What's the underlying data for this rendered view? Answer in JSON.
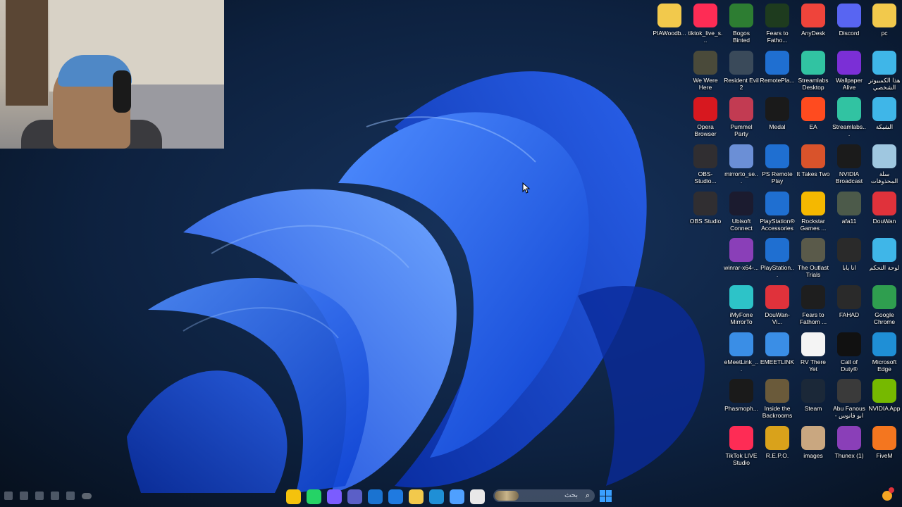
{
  "desktop": {
    "icons": [
      {
        "label": "PIAWoodb...",
        "col": 0,
        "row": 0,
        "icon": "folder-icon",
        "color": "#f2c94c"
      },
      {
        "label": "tiktok_live_s...",
        "col": 1,
        "row": 0,
        "icon": "tiktok-icon",
        "color": "#fe2c55"
      },
      {
        "label": "Bogos Binted",
        "col": 2,
        "row": 0,
        "icon": "alien-icon",
        "color": "#2d7d32"
      },
      {
        "label": "Fears to Fatho...",
        "col": 3,
        "row": 0,
        "icon": "f2f-icon",
        "color": "#1e3b1e"
      },
      {
        "label": "AnyDesk",
        "col": 4,
        "row": 0,
        "icon": "anydesk-icon",
        "color": "#ef443b"
      },
      {
        "label": "Discord",
        "col": 5,
        "row": 0,
        "icon": "discord-icon",
        "color": "#5865f2"
      },
      {
        "label": "pc",
        "col": 6,
        "row": 0,
        "icon": "folder-icon",
        "color": "#f2c94c"
      },
      {
        "label": "We Were Here",
        "col": 1,
        "row": 1,
        "icon": "game-icon",
        "color": "#4a4a3a"
      },
      {
        "label": "Resident Evil 2",
        "col": 2,
        "row": 1,
        "icon": "game-icon",
        "color": "#3a4a5a"
      },
      {
        "label": "RemotePla...",
        "col": 3,
        "row": 1,
        "icon": "playstation-icon",
        "color": "#1f6fd1"
      },
      {
        "label": "Streamlabs Desktop",
        "col": 4,
        "row": 1,
        "icon": "streamlabs-icon",
        "color": "#31c3a2"
      },
      {
        "label": "Wallpaper Alive",
        "col": 5,
        "row": 1,
        "icon": "wallpaper-alive-icon",
        "color": "#7b2fd6"
      },
      {
        "label": "هذا الكمبيوتر الشخصي",
        "col": 6,
        "row": 1,
        "icon": "monitor-icon",
        "color": "#3fb6e8"
      },
      {
        "label": "Opera Browser",
        "col": 1,
        "row": 2,
        "icon": "opera-icon",
        "color": "#d7181f"
      },
      {
        "label": "Pummel Party",
        "col": 2,
        "row": 2,
        "icon": "dice-icon",
        "color": "#c23b52"
      },
      {
        "label": "Medal",
        "col": 3,
        "row": 2,
        "icon": "medal-icon",
        "color": "#1a1a1a"
      },
      {
        "label": "EA",
        "col": 4,
        "row": 2,
        "icon": "ea-icon",
        "color": "#ff4b1f"
      },
      {
        "label": "Streamlabs...",
        "col": 5,
        "row": 2,
        "icon": "streamlabs-icon",
        "color": "#31c3a2"
      },
      {
        "label": "الشبكة",
        "col": 6,
        "row": 2,
        "icon": "network-icon",
        "color": "#3fb6e8"
      },
      {
        "label": "OBS-Studio...",
        "col": 1,
        "row": 3,
        "icon": "obs-icon",
        "color": "#302e31"
      },
      {
        "label": "mirrorto_se...",
        "col": 2,
        "row": 3,
        "icon": "puzzle-icon",
        "color": "#6b8fd6"
      },
      {
        "label": "PS Remote Play",
        "col": 3,
        "row": 3,
        "icon": "playstation-icon",
        "color": "#1f6fd1"
      },
      {
        "label": "It Takes Two",
        "col": 4,
        "row": 3,
        "icon": "game-icon",
        "color": "#d9532b"
      },
      {
        "label": "NVIDIA Broadcast",
        "col": 5,
        "row": 3,
        "icon": "nvidia-icon",
        "color": "#1b1b1b"
      },
      {
        "label": "سلة المحذوفات",
        "col": 6,
        "row": 3,
        "icon": "recycle-bin-icon",
        "color": "#9fc7e0"
      },
      {
        "label": "OBS Studio",
        "col": 1,
        "row": 4,
        "icon": "obs-icon",
        "color": "#302e31"
      },
      {
        "label": "Ubisoft Connect",
        "col": 2,
        "row": 4,
        "icon": "ubisoft-icon",
        "color": "#1b1b2f"
      },
      {
        "label": "PlayStation® Accessories",
        "col": 3,
        "row": 4,
        "icon": "playstation-icon",
        "color": "#1f6fd1"
      },
      {
        "label": "Rockstar Games ...",
        "col": 4,
        "row": 4,
        "icon": "rockstar-icon",
        "color": "#f5b800"
      },
      {
        "label": "afa11",
        "col": 5,
        "row": 4,
        "icon": "image-icon",
        "color": "#4c5a4a"
      },
      {
        "label": "DouWan",
        "col": 6,
        "row": 4,
        "icon": "douwan-icon",
        "color": "#e0323b"
      },
      {
        "label": "winrar-x64-...",
        "col": 1,
        "row": 5,
        "icon": "winrar-icon",
        "color": "#8a3fb8"
      },
      {
        "label": "PlayStation...",
        "col": 2,
        "row": 5,
        "icon": "playstation-icon",
        "color": "#1f6fd1"
      },
      {
        "label": "The Outlast Trials",
        "col": 3,
        "row": 5,
        "icon": "game-icon",
        "color": "#5a5a4a"
      },
      {
        "label": "انا يابا",
        "col": 4,
        "row": 5,
        "icon": "video-icon",
        "color": "#2a2a2a"
      },
      {
        "label": "لوحة التحكم",
        "col": 5,
        "row": 5,
        "icon": "control-panel-icon",
        "color": "#3fb6e8"
      },
      {
        "label": "iMyFone MirrorTo",
        "col": 1,
        "row": 6,
        "icon": "mirrorto-icon",
        "color": "#2dc3c8"
      },
      {
        "label": "DouWan-Vi...",
        "col": 2,
        "row": 6,
        "icon": "douwan-icon",
        "color": "#e0323b"
      },
      {
        "label": "Fears to Fathom ...",
        "col": 3,
        "row": 6,
        "icon": "f2f-icon",
        "color": "#1e1e1e"
      },
      {
        "label": "FAHAD",
        "col": 4,
        "row": 6,
        "icon": "video-icon",
        "color": "#2a2a2a"
      },
      {
        "label": "Google Chrome",
        "col": 5,
        "row": 6,
        "icon": "chrome-icon",
        "color": "#2f9e4f"
      },
      {
        "label": "eMeetLink_...",
        "col": 1,
        "row": 7,
        "icon": "emeet-icon",
        "color": "#3a8ee6"
      },
      {
        "label": "EMEETLINK",
        "col": 2,
        "row": 7,
        "icon": "emeet-icon",
        "color": "#3a8ee6"
      },
      {
        "label": "RV There Yet",
        "col": 3,
        "row": 7,
        "icon": "file-icon",
        "color": "#f4f4f4"
      },
      {
        "label": "Call of Duty®",
        "col": 4,
        "row": 7,
        "icon": "cod-icon",
        "color": "#111111"
      },
      {
        "label": "Microsoft Edge",
        "col": 5,
        "row": 7,
        "icon": "edge-icon",
        "color": "#1f8fd6"
      },
      {
        "label": "Phasmoph...",
        "col": 1,
        "row": 8,
        "icon": "phasmophobia-icon",
        "color": "#1a1a1a"
      },
      {
        "label": "Inside the Backrooms",
        "col": 2,
        "row": 8,
        "icon": "game-icon",
        "color": "#6a5a3a"
      },
      {
        "label": "Steam",
        "col": 3,
        "row": 8,
        "icon": "steam-icon",
        "color": "#1b2838"
      },
      {
        "label": "Abu Fanous - ابو فانوس",
        "col": 4,
        "row": 8,
        "icon": "video-icon",
        "color": "#3a3a3a"
      },
      {
        "label": "NVIDIA App",
        "col": 5,
        "row": 8,
        "icon": "nvidia-icon",
        "color": "#76b900"
      },
      {
        "label": "TikTok LIVE Studio",
        "col": 1,
        "row": 9,
        "icon": "tiktok-icon",
        "color": "#fe2c55"
      },
      {
        "label": "R.E.P.O.",
        "col": 2,
        "row": 9,
        "icon": "repo-icon",
        "color": "#d9a21b"
      },
      {
        "label": "images",
        "col": 3,
        "row": 9,
        "icon": "image-icon",
        "color": "#c9a780"
      },
      {
        "label": "Thunex (1)",
        "col": 4,
        "row": 9,
        "icon": "winrar-icon",
        "color": "#8a3fb8"
      },
      {
        "label": "FiveM",
        "col": 5,
        "row": 9,
        "icon": "fivem-icon",
        "color": "#f4761f"
      }
    ]
  },
  "taskbar": {
    "search_text": "بحث",
    "apps": [
      {
        "icon": "chrome-icon",
        "color": "#f4c20d"
      },
      {
        "icon": "whatsapp-icon",
        "color": "#25d366"
      },
      {
        "icon": "messenger-icon",
        "color": "#7b5cff"
      },
      {
        "icon": "teams-icon",
        "color": "#5b5fc7"
      },
      {
        "icon": "outlook-icon",
        "color": "#1a73d1"
      },
      {
        "icon": "store-icon",
        "color": "#1f7ae0"
      },
      {
        "icon": "file-explorer-icon",
        "color": "#f2c94c"
      },
      {
        "icon": "edge-icon",
        "color": "#1f8fd6"
      },
      {
        "icon": "copilot-icon",
        "color": "#4fa0ff"
      },
      {
        "icon": "app-icon",
        "color": "#e8e8e8"
      }
    ]
  }
}
